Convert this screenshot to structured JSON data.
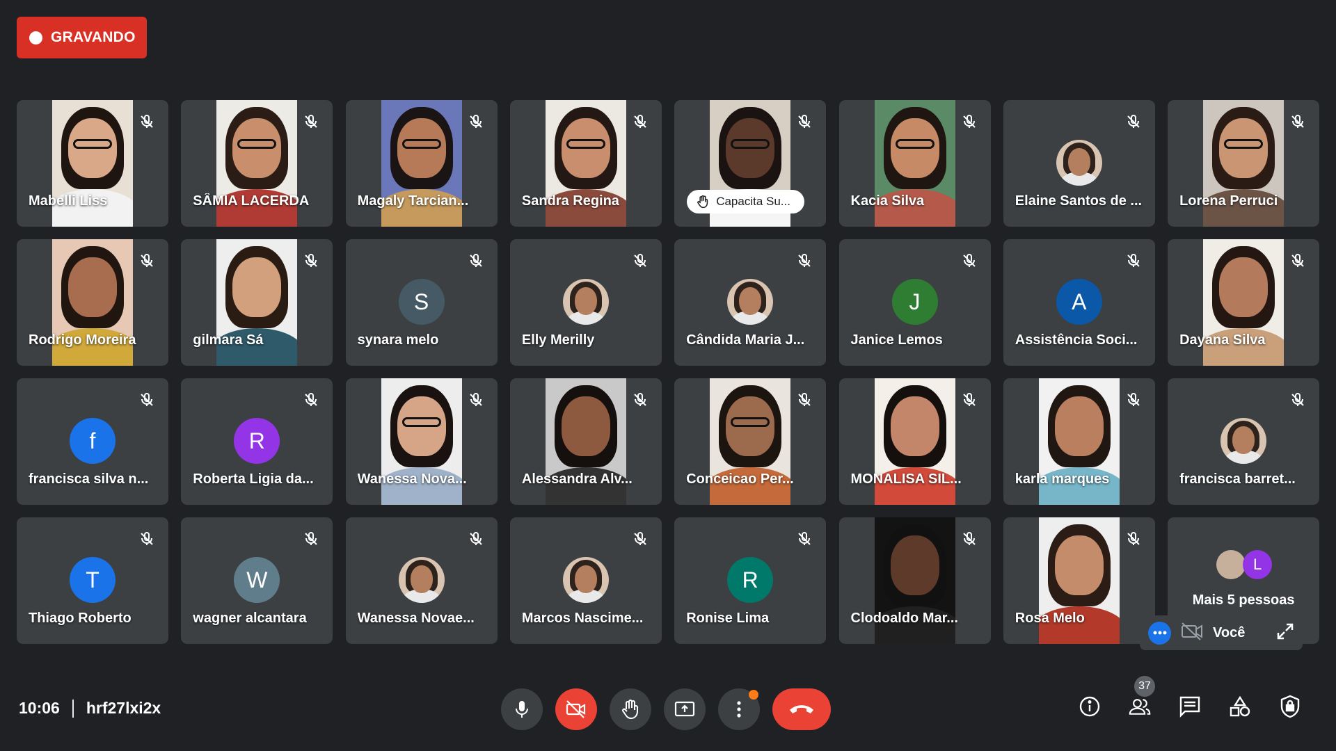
{
  "recording": {
    "label": "GRAVANDO"
  },
  "participants": [
    {
      "name": "Mabelli Liss",
      "kind": "video",
      "skin": "#d9a888",
      "hair": "#1e1410",
      "shirt": "#f2f2f2",
      "bg": "#e8e0d4",
      "glasses": true
    },
    {
      "name": "SÂMIA LACERDA",
      "kind": "video",
      "skin": "#c98f6c",
      "hair": "#2b1d16",
      "shirt": "#b03a34",
      "bg": "#ecebe6",
      "glasses": true
    },
    {
      "name": "Magaly Tarcian...",
      "kind": "video",
      "skin": "#b77a58",
      "hair": "#1a1414",
      "shirt": "#c59a5c",
      "bg": "#6a77b8",
      "glasses": true
    },
    {
      "name": "Sandra Regina",
      "kind": "video",
      "skin": "#c98e6d",
      "hair": "#231814",
      "shirt": "#8a4a3c",
      "bg": "#ece8e2",
      "glasses": true
    },
    {
      "name": "Capacita Su...",
      "kind": "video-pill",
      "skin": "#5b3a2b",
      "hair": "#1b1311",
      "shirt": "#f5f5f5",
      "bg": "#d8cfc4",
      "glasses": true
    },
    {
      "name": "Kacia Silva",
      "kind": "video",
      "skin": "#c68a66",
      "hair": "#1f1612",
      "shirt": "#b55a4a",
      "bg": "#5a8a66",
      "glasses": true
    },
    {
      "name": "Elaine Santos de ...",
      "kind": "photo"
    },
    {
      "name": "Lorena Perruci",
      "kind": "video",
      "skin": "#c99573",
      "hair": "#2a1c15",
      "shirt": "#6b5346",
      "bg": "#cdc6bf",
      "glasses": true
    },
    {
      "name": "Rodrigo Moreira",
      "kind": "video",
      "skin": "#a86d4f",
      "hair": "#20150f",
      "shirt": "#d1a83a",
      "bg": "#e6c8b5",
      "glasses": false
    },
    {
      "name": "gilmara Sá",
      "kind": "video",
      "skin": "#d3a07e",
      "hair": "#2a1c12",
      "shirt": "#2f5a6a",
      "bg": "#eeeeee",
      "glasses": false
    },
    {
      "name": "synara melo",
      "kind": "letter",
      "letter": "S",
      "color": "#455a64"
    },
    {
      "name": "Elly Merilly",
      "kind": "photo"
    },
    {
      "name": "Cândida Maria J...",
      "kind": "photo"
    },
    {
      "name": "Janice Lemos",
      "kind": "letter",
      "letter": "J",
      "color": "#2e7d32"
    },
    {
      "name": "Assistência Soci...",
      "kind": "letter",
      "letter": "A",
      "color": "#0b57a8"
    },
    {
      "name": "Dayana Silva",
      "kind": "video",
      "skin": "#b37a5b",
      "hair": "#241711",
      "shirt": "#caa07a",
      "bg": "#f0ece6",
      "glasses": false
    },
    {
      "name": "francisca silva n...",
      "kind": "letter",
      "letter": "f",
      "color": "#1a73e8"
    },
    {
      "name": "Roberta Ligia da...",
      "kind": "letter",
      "letter": "R",
      "color": "#9334e6"
    },
    {
      "name": "Wanessa Nova...",
      "kind": "video",
      "skin": "#d6a487",
      "hair": "#1a1210",
      "shirt": "#9fb2c9",
      "bg": "#ededed",
      "glasses": true
    },
    {
      "name": "Alessandra Alv...",
      "kind": "video",
      "skin": "#8e5a3f",
      "hair": "#15100d",
      "shirt": "#333333",
      "bg": "#c9c9c9",
      "glasses": false
    },
    {
      "name": "Conceicao Per...",
      "kind": "video",
      "skin": "#9c6a4d",
      "hair": "#1c140f",
      "shirt": "#c56a3a",
      "bg": "#e9e4de",
      "glasses": true
    },
    {
      "name": "MONALISA SIL...",
      "kind": "video",
      "skin": "#c4866a",
      "hair": "#150f0d",
      "shirt": "#d14a3a",
      "bg": "#f4efe9",
      "glasses": false
    },
    {
      "name": "karla marques",
      "kind": "video",
      "skin": "#b97f5f",
      "hair": "#201612",
      "shirt": "#77b6c9",
      "bg": "#f1f1f1",
      "glasses": false
    },
    {
      "name": "francisca barret...",
      "kind": "photo"
    },
    {
      "name": "Thiago Roberto",
      "kind": "letter",
      "letter": "T",
      "color": "#1a73e8"
    },
    {
      "name": "wagner alcantara",
      "kind": "letter",
      "letter": "W",
      "color": "#607d8b"
    },
    {
      "name": "Wanessa Novae...",
      "kind": "photo"
    },
    {
      "name": "Marcos Nascime...",
      "kind": "photo"
    },
    {
      "name": "Ronise Lima",
      "kind": "letter",
      "letter": "R",
      "color": "#00796b"
    },
    {
      "name": "Clodoaldo Mar...",
      "kind": "video",
      "skin": "#5d3a2a",
      "hair": "#111111",
      "shirt": "#202020",
      "bg": "#131313",
      "glasses": false
    },
    {
      "name": "Rosa Melo",
      "kind": "video",
      "skin": "#c48c6b",
      "hair": "#2b1d15",
      "shirt": "#b33a2a",
      "bg": "#eeeeee",
      "glasses": false
    },
    {
      "name": "Mais 5 pessoas",
      "kind": "more",
      "letter": "L"
    }
  ],
  "self_view": {
    "label": "Você"
  },
  "meeting": {
    "time": "10:06",
    "code": "hrf27lxi2x"
  },
  "participants_count": "37",
  "colors": {
    "background": "#202124",
    "tile": "#3c4043",
    "red": "#ea4335",
    "accent": "#1a73e8"
  },
  "icons": {
    "controls": [
      "microphone-icon",
      "camera-off-icon",
      "raise-hand-icon",
      "present-screen-icon",
      "more-options-icon",
      "end-call-icon"
    ],
    "right": [
      "meeting-info-icon",
      "people-icon",
      "chat-icon",
      "activities-icon",
      "host-controls-icon"
    ]
  }
}
